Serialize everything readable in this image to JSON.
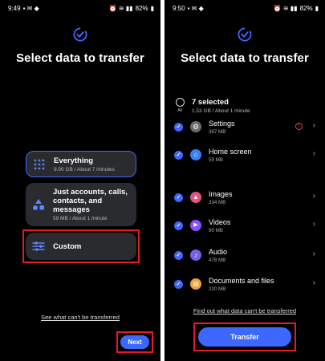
{
  "left": {
    "status": {
      "time": "9:49",
      "battery": "82%"
    },
    "title": "Select data to transfer",
    "options": [
      {
        "label": "Everything",
        "sub": "9.00 GB / About 7 minutes"
      },
      {
        "label": "Just accounts, calls, contacts, and messages",
        "sub": "59 MB / About 1 minute"
      },
      {
        "label": "Custom"
      }
    ],
    "link": "See what can't be transferred",
    "next_label": "Next"
  },
  "right": {
    "status": {
      "time": "9:50",
      "battery": "82%"
    },
    "title": "Select data to transfer",
    "select_all_label": "All",
    "selected_count": "7 selected",
    "selected_sub": "1.53 GB / About 1 minute",
    "items": [
      {
        "name": "Settings",
        "size": "387 MB",
        "icon_color": "#6b6b6b"
      },
      {
        "name": "Home screen",
        "size": "59 MB",
        "icon_color": "#3b7ff5"
      },
      {
        "name": "Images",
        "size": "334 MB",
        "icon_color": "#e0557f"
      },
      {
        "name": "Videos",
        "size": "90 MB",
        "icon_color": "#8a4fff"
      },
      {
        "name": "Audio",
        "size": "478 MB",
        "icon_color": "#7a5cf0"
      },
      {
        "name": "Documents and files",
        "size": "220 MB",
        "icon_color": "#f0a23a"
      }
    ],
    "link": "Find out what data can't be transferred",
    "transfer_label": "Transfer"
  },
  "colors": {
    "accent": "#3d67ff",
    "highlight": "#e31b23",
    "background": "#000000",
    "card": "#2a2b2f"
  }
}
